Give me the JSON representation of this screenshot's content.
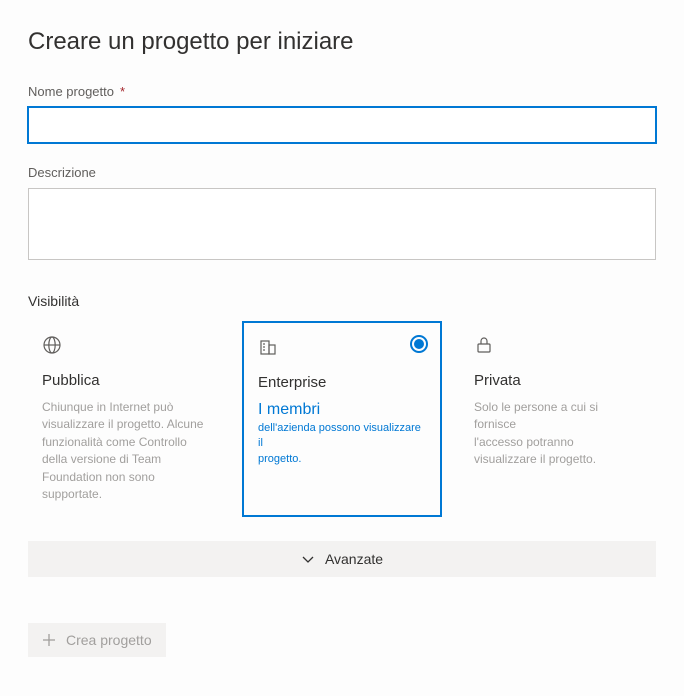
{
  "page": {
    "title": "Creare un progetto per iniziare"
  },
  "fields": {
    "projectName": {
      "label": "Nome progetto",
      "required": "*",
      "value": ""
    },
    "description": {
      "label": "Descrizione",
      "value": ""
    }
  },
  "visibility": {
    "label": "Visibilità",
    "options": {
      "public": {
        "title": "Pubblica",
        "desc": "Chiunque in Internet può visualizzare il progetto. Alcune funzionalità come Controllo della versione di Team Foundation non sono supportate."
      },
      "enterprise": {
        "title": "Enterprise",
        "highlight": "I membri",
        "sub1": "dell'azienda possono visualizzare il",
        "sub2": "progetto."
      },
      "private": {
        "title": "Privata",
        "line1": "Solo le persone a cui si fornisce",
        "line2": "l'accesso potranno",
        "line3": "visualizzare il progetto."
      }
    }
  },
  "advanced": {
    "label": "Avanzate"
  },
  "createButton": {
    "label": "Crea progetto"
  }
}
